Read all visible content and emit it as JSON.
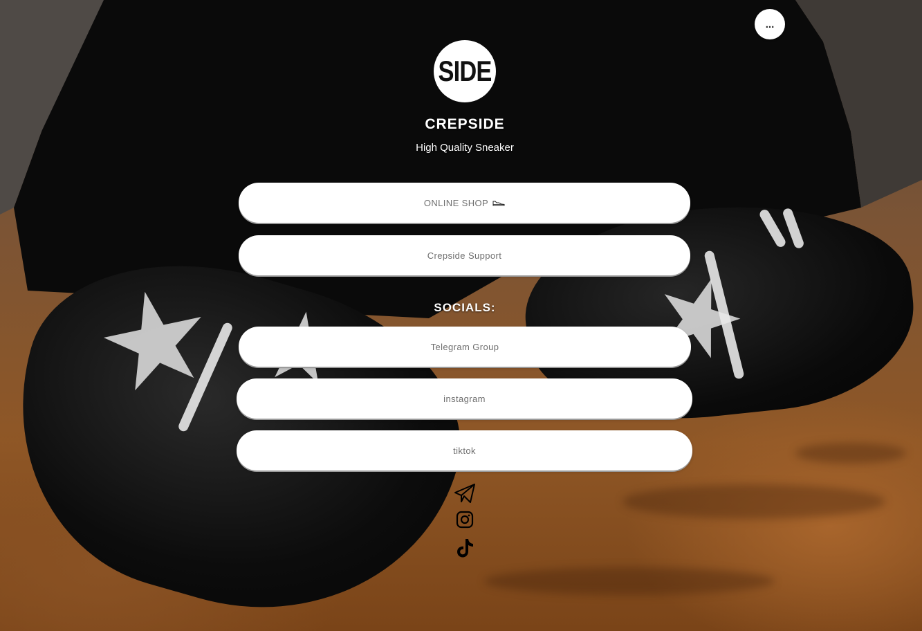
{
  "menu": {
    "label": "..."
  },
  "profile": {
    "avatar_text": "SIDE",
    "title": "CREPSIDE",
    "description": "High Quality Sneaker"
  },
  "links": [
    {
      "label": "ONLINE SHOP",
      "icon": "sneaker-icon"
    },
    {
      "label": "Crepside Support"
    }
  ],
  "socials": {
    "heading": "SOCIALS:",
    "links": [
      {
        "label": "Telegram Group"
      },
      {
        "label": "instagram"
      },
      {
        "label": "tiktok"
      }
    ],
    "icons": [
      "telegram-icon",
      "instagram-icon",
      "tiktok-icon"
    ]
  },
  "colors": {
    "button_bg": "#ffffff",
    "button_text": "#6e6e6e",
    "heading_text": "#ffffff"
  }
}
